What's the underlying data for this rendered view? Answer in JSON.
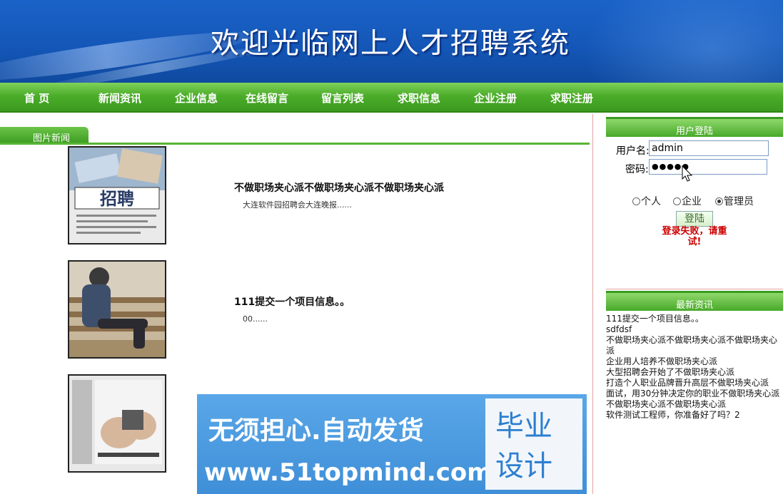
{
  "header": {
    "title": "欢迎光临网上人才招聘系统"
  },
  "nav": {
    "items": [
      "首 页",
      "新闻资讯",
      "企业信息",
      "在线留言",
      "留言列表",
      "求职信息",
      "企业注册",
      "求职注册"
    ]
  },
  "picture_news": {
    "tab_label": "图片新闻",
    "items": [
      {
        "title": "不做职场夹心派不做职场夹心派不做职场夹心派",
        "summary": "大连软件园招聘会大连晚报......",
        "thumb": "招聘"
      },
      {
        "title": "111提交一个项目信息。。",
        "summary": "00......",
        "thumb": ""
      },
      {
        "title": "大型招聘会开始了不做职场夹心派",
        "summary": "",
        "thumb": ""
      }
    ]
  },
  "ad": {
    "line1": "无须担心.自动发货",
    "line2": "www.51topmind.com",
    "box_line1": "毕业",
    "box_line2": "设计"
  },
  "login": {
    "header": "用户登陆",
    "username_label": "用户名:",
    "username_value": "admin",
    "password_label": "密码:",
    "password_value": "●●●●●",
    "roles": [
      "个人",
      "企业",
      "管理员"
    ],
    "selected_role": "管理员",
    "submit_label": "登陆",
    "error_line1": "登录失败，请重",
    "error_line2": "试!"
  },
  "latest": {
    "header": "最新资讯",
    "items": [
      "111提交一个项目信息。。",
      "sdfdsf",
      "不做职场夹心派不做职场夹心派不做职场夹心派",
      "企业用人培养不做职场夹心派",
      "大型招聘会开始了不做职场夹心派",
      "打造个人职业品牌晋升高层不做职场夹心派",
      "面试，用30分钟决定你的职业不做职场夹心派",
      "不做职场夹心派不做职场夹心派",
      "软件测试工程师，你准备好了吗？2"
    ]
  },
  "colors": {
    "banner": "#1457b8",
    "nav": "#4cad2a",
    "accent_red": "#cc0000"
  }
}
